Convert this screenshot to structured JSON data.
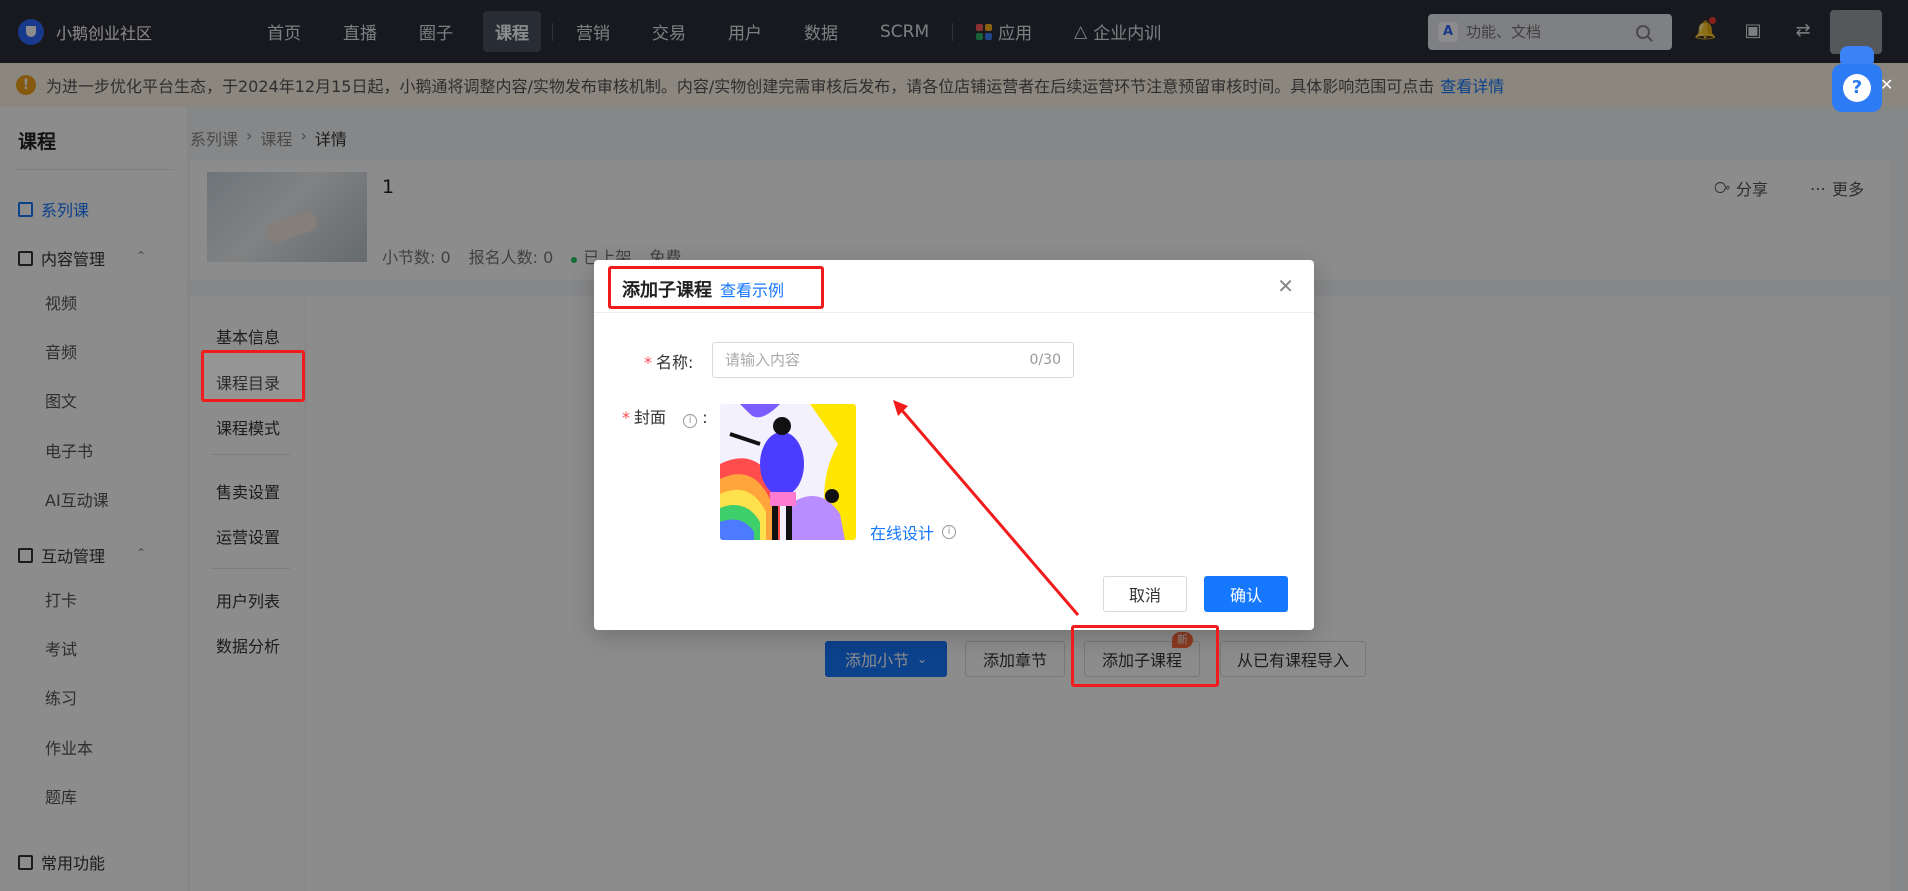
{
  "app": {
    "name": "小鹅创业社区",
    "nav": [
      "首页",
      "直播",
      "圈子",
      "课程",
      "营销",
      "交易",
      "用户",
      "数据",
      "SCRM",
      "应用",
      "企业内训"
    ],
    "active_nav": "课程",
    "search_placeholder": "功能、文档",
    "search_prefix": "A"
  },
  "notice": {
    "text": "为进一步优化平台生态，于2024年12月15日起，小鹅通将调整内容/实物发布审核机制。内容/实物创建完需审核后发布，请各位店铺运营者在后续运营环节注意预留审核时间。具体影响范围可点击",
    "link": "查看详情"
  },
  "sidebar": {
    "title": "课程",
    "active_item": "系列课",
    "group_content": "内容管理",
    "content_items": [
      "视频",
      "音频",
      "图文",
      "电子书",
      "AI互动课"
    ],
    "group_interact": "互动管理",
    "interact_items": [
      "打卡",
      "考试",
      "练习",
      "作业本",
      "题库"
    ],
    "common": "常用功能"
  },
  "breadcrumb": [
    "系列课",
    "课程",
    "详情"
  ],
  "course": {
    "name": "1",
    "lessons": "小节数: 0",
    "signups": "报名人数: 0",
    "status": "已上架",
    "price": "免费",
    "share": "分享",
    "more": "更多"
  },
  "detail_tabs": [
    "基本信息",
    "课程目录",
    "课程模式",
    "售卖设置",
    "运营设置",
    "用户列表",
    "数据分析"
  ],
  "actions": {
    "add_section": "添加小节",
    "add_chapter": "添加章节",
    "add_subcourse": "添加子课程",
    "new_badge": "新",
    "import": "从已有课程导入"
  },
  "modal": {
    "title": "添加子课程",
    "example_link": "查看示例",
    "name_label": "名称:",
    "name_placeholder": "请输入内容",
    "name_counter": "0/30",
    "cover_label": "封面",
    "cover_suffix": ":",
    "design_link": "在线设计",
    "cancel": "取消",
    "confirm": "确认"
  },
  "colors": {
    "topbar": "#2b2f3a",
    "primary": "#1677ff",
    "highlight": "#f21b1b",
    "notice_bg": "#fff6e5"
  },
  "icons": [
    "search-icon",
    "bell-icon",
    "store-icon",
    "switch-icon",
    "share-icon",
    "more-icon",
    "close-icon",
    "info-icon",
    "warning-icon",
    "help-icon"
  ]
}
